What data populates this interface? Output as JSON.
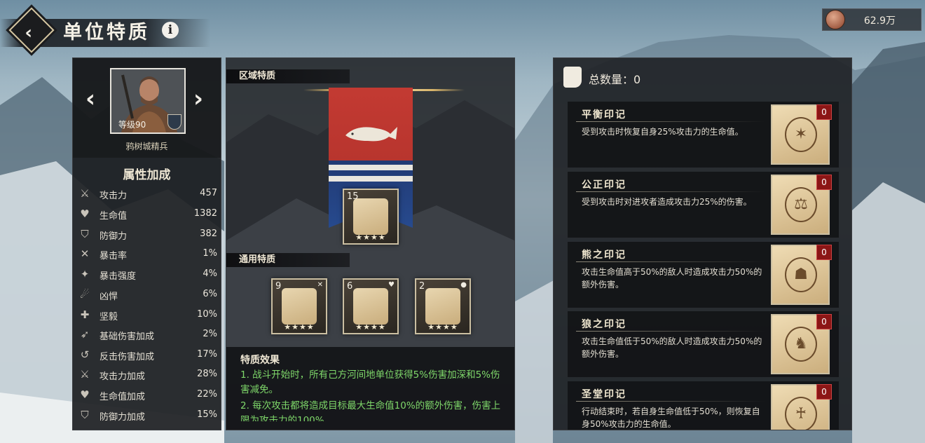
{
  "header": {
    "title": "单位特质",
    "currency_value": "62.9万"
  },
  "unit": {
    "level_text": "等级90",
    "name": "鸦树城精兵"
  },
  "attributes": {
    "title": "属性加成",
    "stats": [
      {
        "label": "攻击力",
        "value": "457",
        "icon": "sword-icon"
      },
      {
        "label": "生命值",
        "value": "1382",
        "icon": "heart-icon"
      },
      {
        "label": "防御力",
        "value": "382",
        "icon": "shield-icon"
      },
      {
        "label": "暴击率",
        "value": "1%",
        "icon": "crit-rate-icon"
      },
      {
        "label": "暴击强度",
        "value": "4%",
        "icon": "crit-strength-icon"
      },
      {
        "label": "凶悍",
        "value": "6%",
        "icon": "ferocity-icon"
      },
      {
        "label": "坚毅",
        "value": "10%",
        "icon": "fortitude-icon"
      },
      {
        "label": "基础伤害加成",
        "value": "2%",
        "icon": "base-damage-icon"
      },
      {
        "label": "反击伤害加成",
        "value": "17%",
        "icon": "counter-damage-icon"
      },
      {
        "label": "攻击力加成",
        "value": "28%",
        "icon": "attack-bonus-icon"
      },
      {
        "label": "生命值加成",
        "value": "22%",
        "icon": "health-bonus-icon"
      },
      {
        "label": "防御力加成",
        "value": "15%",
        "icon": "defense-bonus-icon"
      }
    ]
  },
  "regional": {
    "header": "区域特质",
    "trait": {
      "count": "15",
      "stars": "★★★★"
    }
  },
  "general": {
    "header": "通用特质",
    "traits": [
      {
        "count": "9",
        "stars": "★★★★",
        "mark": "✕"
      },
      {
        "count": "6",
        "stars": "★★★★",
        "mark": "♥"
      },
      {
        "count": "2",
        "stars": "★★★★",
        "mark": "●"
      }
    ]
  },
  "effects": {
    "title": "特质效果",
    "lines": [
      "1. 战斗开始时，所有己方河间地单位获得5%伤害加深和5%伤害减免。",
      "2. 每次攻击都将造成目标最大生命值10%的额外伤害，伤害上限为攻击力的100%"
    ]
  },
  "seals": {
    "total_label": "总数量：0",
    "items": [
      {
        "name": "平衡印记",
        "desc": "受到攻击时恢复自身25%攻击力的生命值。",
        "badge": "0",
        "emblem": "✶"
      },
      {
        "name": "公正印记",
        "desc": "受到攻击时对进攻者造成攻击力25%的伤害。",
        "badge": "0",
        "emblem": "⚖"
      },
      {
        "name": "熊之印记",
        "desc": "攻击生命值高于50%的敌人时造成攻击力50%的额外伤害。",
        "badge": "0",
        "emblem": "☗"
      },
      {
        "name": "狼之印记",
        "desc": "攻击生命值低于50%的敌人时造成攻击力50%的额外伤害。",
        "badge": "0",
        "emblem": "♞"
      },
      {
        "name": "圣堂印记",
        "desc": "行动结束时，若自身生命值低于50%，则恢复自身50%攻击力的生命值。",
        "badge": "0",
        "emblem": "♰"
      }
    ]
  }
}
